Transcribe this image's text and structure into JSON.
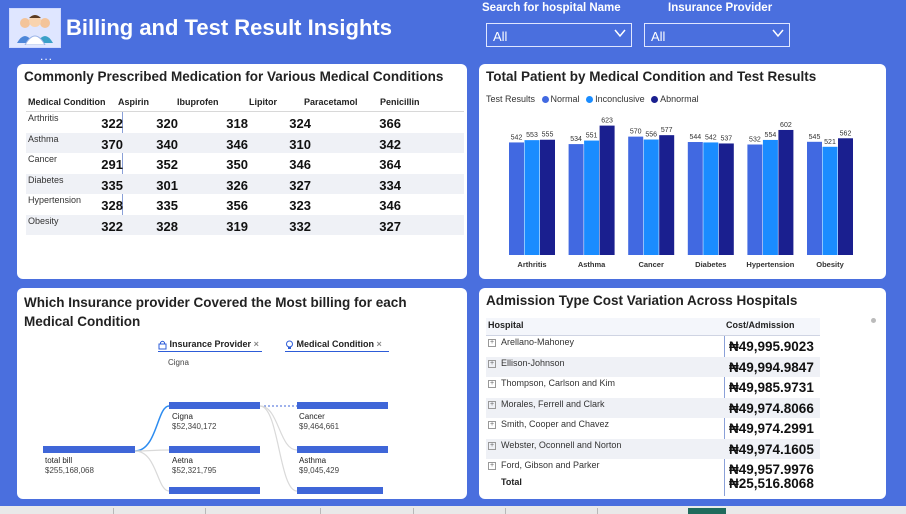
{
  "header": {
    "title": "Billing and Test Result Insights",
    "logo_icon": "doctors-group-icon",
    "more_glyph": "..."
  },
  "slicers": {
    "hospital": {
      "label": "Search for hospital Name",
      "value": "All"
    },
    "insurance": {
      "label": "Insurance Provider",
      "value": "All"
    }
  },
  "medication_matrix": {
    "title": "Commonly Prescribed Medication for Various Medical Conditions",
    "columns": [
      "Medical Condition",
      "Aspirin",
      "Ibuprofen",
      "Lipitor",
      "Paracetamol",
      "Penicillin"
    ],
    "rows": [
      {
        "condition": "Arthritis",
        "values": [
          "322",
          "320",
          "318",
          "324",
          "366"
        ]
      },
      {
        "condition": "Asthma",
        "values": [
          "370",
          "340",
          "346",
          "310",
          "342"
        ]
      },
      {
        "condition": "Cancer",
        "values": [
          "291",
          "352",
          "350",
          "346",
          "364"
        ]
      },
      {
        "condition": "Diabetes",
        "values": [
          "335",
          "301",
          "326",
          "327",
          "334"
        ]
      },
      {
        "condition": "Hypertension",
        "values": [
          "328",
          "335",
          "356",
          "323",
          "346"
        ]
      },
      {
        "condition": "Obesity",
        "values": [
          "322",
          "328",
          "319",
          "332",
          "327"
        ]
      }
    ]
  },
  "patients_chart": {
    "title": "Total Patient by Medical Condition and Test Results",
    "legend_title": "Test Results",
    "colors": {
      "Normal": "#4169e1",
      "Inconclusive": "#1a8cff",
      "Abnormal": "#1a1f8f"
    },
    "chart_data": {
      "type": "bar",
      "categories": [
        "Arthritis",
        "Asthma",
        "Cancer",
        "Diabetes",
        "Hypertension",
        "Obesity"
      ],
      "series": [
        {
          "name": "Normal",
          "values": [
            542,
            534,
            570,
            544,
            532,
            545
          ]
        },
        {
          "name": "Inconclusive",
          "values": [
            553,
            551,
            556,
            542,
            554,
            521
          ]
        },
        {
          "name": "Abnormal",
          "values": [
            555,
            623,
            577,
            537,
            602,
            562
          ]
        }
      ],
      "ylim": [
        0,
        650
      ]
    }
  },
  "insurance_tree": {
    "title": "Which Insurance provider Covered the Most billing for each Medical Condition",
    "field1": "Insurance Provider",
    "field2": "Medical Condition",
    "field1_selected": "Cigna",
    "remove_glyph": "×",
    "root": {
      "label": "total bill",
      "value": "$255,168,068"
    },
    "level1": [
      {
        "label": "Cigna",
        "value": "$52,340,172"
      },
      {
        "label": "Aetna",
        "value": "$52,321,795"
      }
    ],
    "level2": [
      {
        "label": "Cancer",
        "value": "$9,464,661"
      },
      {
        "label": "Asthma",
        "value": "$9,045,429"
      }
    ]
  },
  "admission_table": {
    "title": "Admission Type Cost Variation Across Hospitals",
    "columns": [
      "Hospital",
      "Cost/Admission"
    ],
    "expand_glyph": "+",
    "rows": [
      {
        "hospital": "Arellano-Mahoney",
        "cost": "₦49,995.9023"
      },
      {
        "hospital": "Ellison-Johnson",
        "cost": "₦49,994.9847"
      },
      {
        "hospital": "Thompson, Carlson and Kim",
        "cost": "₦49,985.9731"
      },
      {
        "hospital": "Morales, Ferrell and Clark",
        "cost": "₦49,974.8066"
      },
      {
        "hospital": "Smith, Cooper and Chavez",
        "cost": "₦49,974.2991"
      },
      {
        "hospital": "Webster, Oconnell and Norton",
        "cost": "₦49,974.1605"
      },
      {
        "hospital": "Ford, Gibson and Parker",
        "cost": "₦49,957.9976"
      }
    ],
    "total_label": "Total",
    "total_value": "₦25,516.8068"
  }
}
